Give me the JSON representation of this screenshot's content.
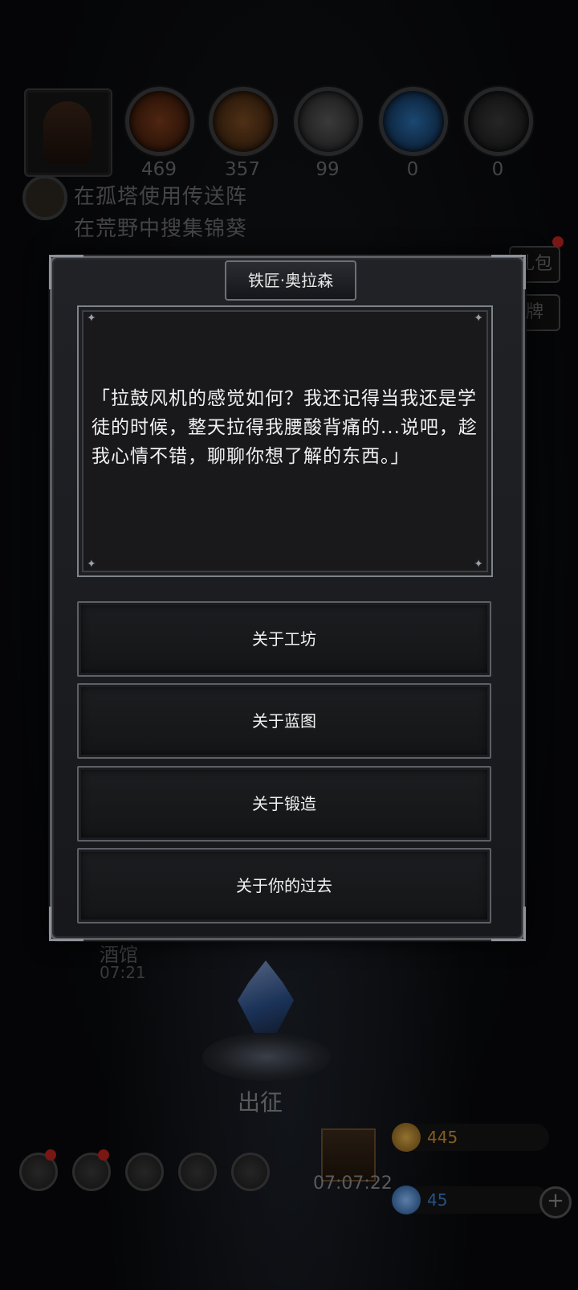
{
  "resources": [
    {
      "name": "ore-icon",
      "count": "469",
      "color": "#7a3a1a"
    },
    {
      "name": "wood-icon",
      "count": "357",
      "color": "#7a4a22"
    },
    {
      "name": "iron-bar-icon",
      "count": "99",
      "color": "#5a5a5a"
    },
    {
      "name": "crystal-icon",
      "count": "0",
      "color": "#2a6fb0"
    },
    {
      "name": "dark-metal-icon",
      "count": "0",
      "color": "#3a3a3a"
    }
  ],
  "quests": [
    "在孤塔使用传送阵",
    "在荒野中搜集锦葵"
  ],
  "side_buttons": {
    "pack": "礼包",
    "card": "牌"
  },
  "scene": {
    "tavern": "酒馆",
    "tavern_time": "07:21",
    "expedition": "出征"
  },
  "dock": {
    "gift_timer": "07:07:22",
    "gold": "445",
    "gems": "45",
    "plus": "+"
  },
  "dialog": {
    "title": "铁匠·奥拉森",
    "text": "「拉鼓风机的感觉如何？我还记得当我还是学徒的时候，整天拉得我腰酸背痛的...说吧，趁我心情不错，聊聊你想了解的东西。」",
    "options": [
      "关于工坊",
      "关于蓝图",
      "关于锻造",
      "关于你的过去"
    ]
  },
  "colors": {
    "gold": "#c9912e",
    "gem": "#3d7fc9",
    "alert": "#b8241f"
  }
}
